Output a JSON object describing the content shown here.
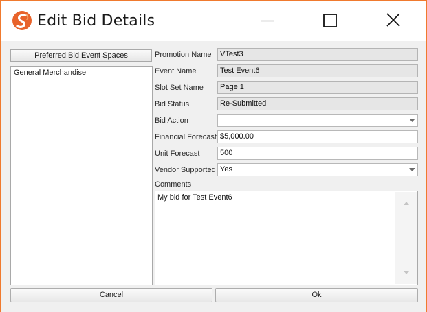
{
  "window": {
    "title": "Edit Bid Details",
    "accent_color": "#f07a2e",
    "icons": {
      "minimize": "minimize-icon",
      "maximize": "maximize-icon",
      "close": "close-icon",
      "logo": "app-logo-icon"
    }
  },
  "left_panel": {
    "header_label": "Preferred Bid Event Spaces",
    "items": [
      {
        "label": "General Merchandise"
      }
    ]
  },
  "form": {
    "promotion_name": {
      "label": "Promotion Name",
      "value": "VTest3"
    },
    "event_name": {
      "label": "Event Name",
      "value": "Test Event6"
    },
    "slot_set_name": {
      "label": "Slot Set Name",
      "value": "Page 1"
    },
    "bid_status": {
      "label": "Bid Status",
      "value": "Re-Submitted"
    },
    "bid_action": {
      "label": "Bid Action",
      "value": ""
    },
    "financial_forecast": {
      "label": "Financial Forecast",
      "value": "$5,000.00"
    },
    "unit_forecast": {
      "label": "Unit Forecast",
      "value": "500"
    },
    "vendor_supported": {
      "label": "Vendor Supported",
      "value": "Yes"
    },
    "comments": {
      "label": "Comments",
      "value": "My bid for Test Event6"
    }
  },
  "buttons": {
    "cancel_label": "Cancel",
    "ok_label": "Ok"
  }
}
